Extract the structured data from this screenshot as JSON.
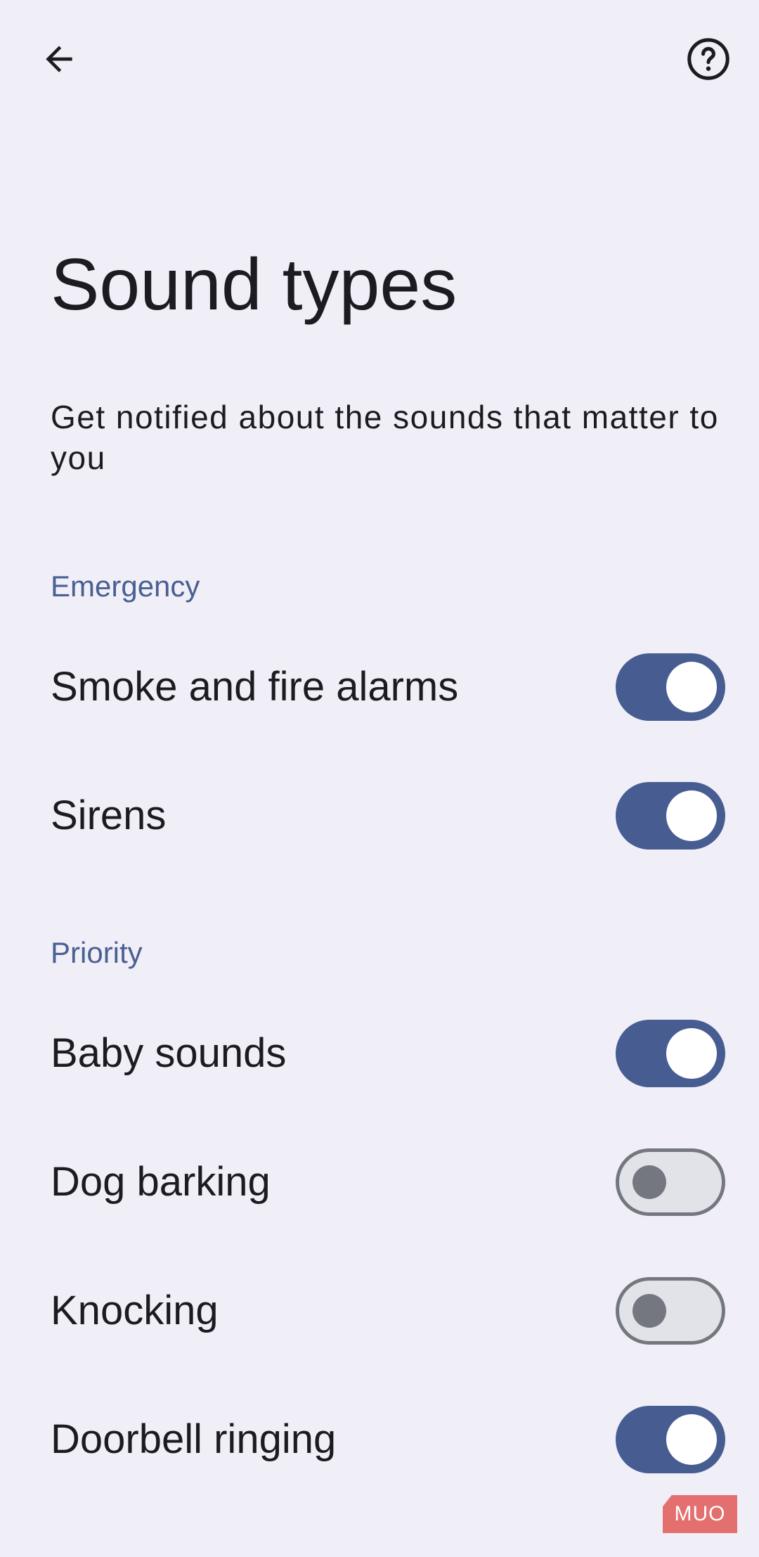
{
  "toolbar": {
    "back_icon": "arrow-back-icon",
    "help_icon": "help-circle-icon"
  },
  "page": {
    "title": "Sound types",
    "description": "Get notified about the sounds that matter to you"
  },
  "sections": [
    {
      "header": "Emergency",
      "items": [
        {
          "label": "Smoke and fire alarms",
          "enabled": true
        },
        {
          "label": "Sirens",
          "enabled": true
        }
      ]
    },
    {
      "header": "Priority",
      "items": [
        {
          "label": "Baby sounds",
          "enabled": true
        },
        {
          "label": "Dog barking",
          "enabled": false
        },
        {
          "label": "Knocking",
          "enabled": false
        },
        {
          "label": "Doorbell ringing",
          "enabled": true
        }
      ]
    }
  ],
  "colors": {
    "background": "#f0eff7",
    "accent": "#475d92",
    "section_header": "#4a5f93",
    "switch_off_outline": "#74777f",
    "switch_off_track": "#e2e2e9"
  },
  "watermark": "MUO"
}
